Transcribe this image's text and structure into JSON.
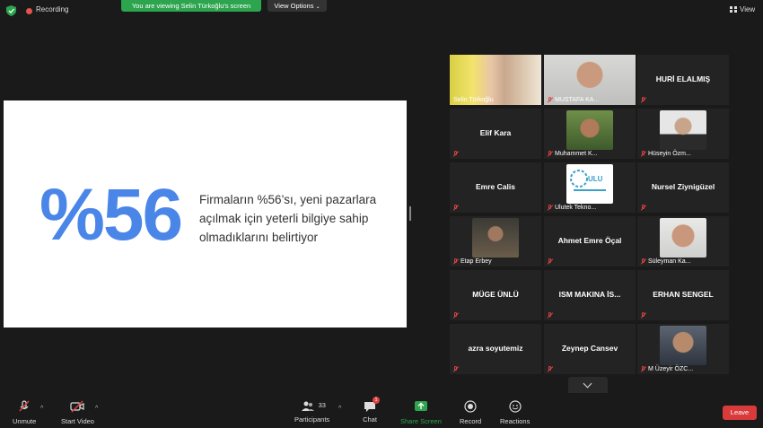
{
  "topbar": {
    "recording_label": "Recording",
    "viewing_label": "You are viewing Selin Türkoğlu's screen",
    "view_options_label": "View Options",
    "view_label": "View"
  },
  "slide": {
    "big_stat": "%56",
    "text": "Firmaların %56’sı, yeni pazarlara açılmak için yeterli bilgiye sahip olmadıklarını belirtiyor"
  },
  "participants": [
    {
      "name": "Selin Türkoğlu",
      "video": true
    },
    {
      "name": "MUSTAFA KA...",
      "video": true
    },
    {
      "name": "HURİ ELALMIŞ",
      "video": false
    },
    {
      "name": "Elif Kara",
      "video": false
    },
    {
      "name": "Muhammet K...",
      "video": true
    },
    {
      "name": "Hüseyin Özm...",
      "video": true
    },
    {
      "name": "Emre Calis",
      "video": false
    },
    {
      "name": "Ulutek Tekno...",
      "video": true
    },
    {
      "name": "Nursel Ziynigüzel",
      "video": false
    },
    {
      "name": "Etap Erbey",
      "video": true
    },
    {
      "name": "Ahmet Emre Öçal",
      "video": false
    },
    {
      "name": "Süleyman Ka...",
      "video": true
    },
    {
      "name": "MÜGE ÜNLÜ",
      "video": false
    },
    {
      "name": "ISM MAKINA İS...",
      "video": false
    },
    {
      "name": "ERHAN SENGEL",
      "video": false
    },
    {
      "name": "azra soyutemiz",
      "video": false
    },
    {
      "name": "Zeynep Cansev",
      "video": false
    },
    {
      "name": "M Üzeyir ÖZC...",
      "video": true
    }
  ],
  "toolbar": {
    "unmute_label": "Unmute",
    "start_video_label": "Start Video",
    "participants_label": "Participants",
    "participants_count": "33",
    "chat_label": "Chat",
    "chat_badge": "1",
    "share_screen_label": "Share Screen",
    "record_label": "Record",
    "reactions_label": "Reactions",
    "leave_label": "Leave"
  },
  "colors": {
    "accent_green": "#2da44e",
    "stat_blue": "#4a86e8",
    "leave_red": "#d93b3b",
    "active_speaker": "#e8d44d"
  }
}
